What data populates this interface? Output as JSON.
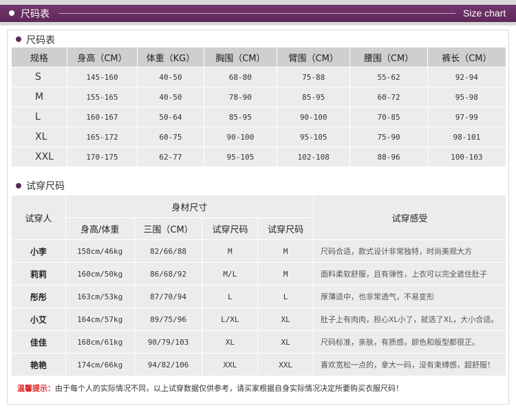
{
  "header": {
    "title": "尺码表",
    "subtitle": "Size chart"
  },
  "size_section": {
    "title": "尺码表",
    "columns": [
      "规格",
      "身高（CM）",
      "体重（KG）",
      "胸围（CM）",
      "臂围（CM）",
      "腰围（CM）",
      "裤长（CM）"
    ],
    "rows": [
      [
        "S",
        "145-160",
        "40-50",
        "68-80",
        "75-88",
        "55-62",
        "92-94"
      ],
      [
        "M",
        "155-165",
        "40-50",
        "78-90",
        "85-95",
        "60-72",
        "95-98"
      ],
      [
        "L",
        "160-167",
        "50-64",
        "85-95",
        "90-100",
        "70-85",
        "97-99"
      ],
      [
        "XL",
        "165-172",
        "60-75",
        "90-100",
        "95-105",
        "75-90",
        "98-101"
      ],
      [
        "XXL",
        "170-175",
        "62-77",
        "95-105",
        "102-108",
        "88-96",
        "100-103"
      ]
    ]
  },
  "trial_section": {
    "title": "试穿尺码",
    "head": {
      "person": "试穿人",
      "body": "身材尺寸",
      "feel": "试穿感受",
      "sub": [
        "身高/体重",
        "三围（CM）",
        "试穿尺码",
        "试穿尺码"
      ]
    },
    "rows": [
      [
        "小李",
        "158cm/46kg",
        "82/66/88",
        "M",
        "M",
        "尺码合适，款式设计非常独特，时尚美观大方"
      ],
      [
        "莉莉",
        "160cm/50kg",
        "86/68/92",
        "M/L",
        "M",
        "面料柔软舒服，且有弹性，上衣可以完全遮住肚子"
      ],
      [
        "彤彤",
        "163cm/53kg",
        "87/70/94",
        "L",
        "L",
        "厚薄适中，也非常透气，不易变形"
      ],
      [
        "小艾",
        "164cm/57kg",
        "89/75/96",
        "L/XL",
        "XL",
        "肚子上有肉肉，担心XL小了，就选了XL，大小合适。"
      ],
      [
        "佳佳",
        "168cm/61kg",
        "90/79/103",
        "XL",
        "XL",
        "尺码标准，亲肤，有质感，颜色和版型都很正。"
      ],
      [
        "艳艳",
        "174cm/66kg",
        "94/82/106",
        "XXL",
        "XXL",
        "喜欢宽松一点的，拿大一码，没有束缚感，超舒服！"
      ]
    ]
  },
  "tip": {
    "label": "温馨提示：",
    "text": "由于每个人的实际情况不同，以上试穿数据仅供参考，请买家根据自身实际情况决定所要购买衣服尺码！"
  }
}
